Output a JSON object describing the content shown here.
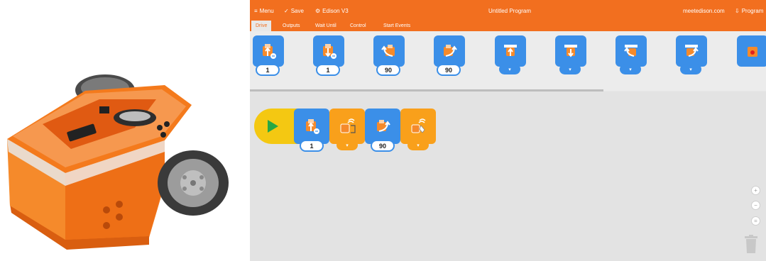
{
  "app": {
    "menu_label": "Menu",
    "save_label": "Save",
    "device_label": "Edison V3",
    "title": "Untitled Program",
    "site_label": "meetedison.com",
    "program_label": "Program"
  },
  "tabs": [
    {
      "label": "Drive",
      "active": true
    },
    {
      "label": "Outputs",
      "active": false
    },
    {
      "label": "Wait Until",
      "active": false
    },
    {
      "label": "Control",
      "active": false
    },
    {
      "label": "Start Events",
      "active": false
    }
  ],
  "palette": {
    "blocks": [
      {
        "icon": "drive-forward-icon",
        "param": "1"
      },
      {
        "icon": "drive-backward-icon",
        "param": "1"
      },
      {
        "icon": "spin-left-icon",
        "param": "90"
      },
      {
        "icon": "spin-right-icon",
        "param": "90"
      },
      {
        "icon": "drive-forward-forever-icon",
        "param": "▾"
      },
      {
        "icon": "drive-backward-forever-icon",
        "param": "▾"
      },
      {
        "icon": "turn-left-forever-icon",
        "param": "▾"
      },
      {
        "icon": "turn-right-forever-icon",
        "param": "▾"
      },
      {
        "icon": "stop-motors-icon",
        "param": ""
      }
    ]
  },
  "program": {
    "blocks": [
      {
        "type": "start",
        "icon": "play-icon"
      },
      {
        "type": "drive",
        "icon": "drive-forward-icon",
        "param": "1"
      },
      {
        "type": "wait",
        "icon": "wait-obstacle-icon",
        "param": "▾"
      },
      {
        "type": "drive",
        "icon": "spin-right-icon",
        "param": "90"
      },
      {
        "type": "wait",
        "icon": "wait-clap-icon",
        "param": "▾"
      }
    ]
  },
  "zoom": {
    "in": "+",
    "out": "−",
    "reset": "="
  },
  "colors": {
    "accent": "#f26f1f",
    "drive_block": "#3b8fe8",
    "wait_block": "#f9a01b",
    "start_block": "#f4c812"
  }
}
